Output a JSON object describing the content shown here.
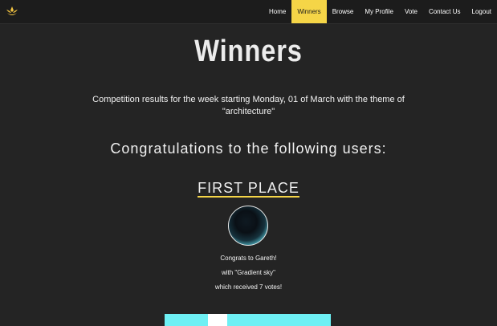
{
  "nav": {
    "items": [
      "Home",
      "Winners",
      "Browse",
      "My Profile",
      "Vote",
      "Contact Us",
      "Logout"
    ],
    "active": "Winners",
    "accent_color": "#f5d547",
    "logo_icon": "lotus-icon"
  },
  "page": {
    "title": "Winners",
    "intro": "Competition results for the week starting Monday, 01 of March with the theme of \"architecture\"",
    "congrats_heading": "Congratulations to the following users:"
  },
  "first_place": {
    "heading": "FIRST PLACE",
    "line1": "Congrats to Gareth!",
    "line2": "with \"Gradient sky\"",
    "line3": "which received 7 votes!"
  }
}
